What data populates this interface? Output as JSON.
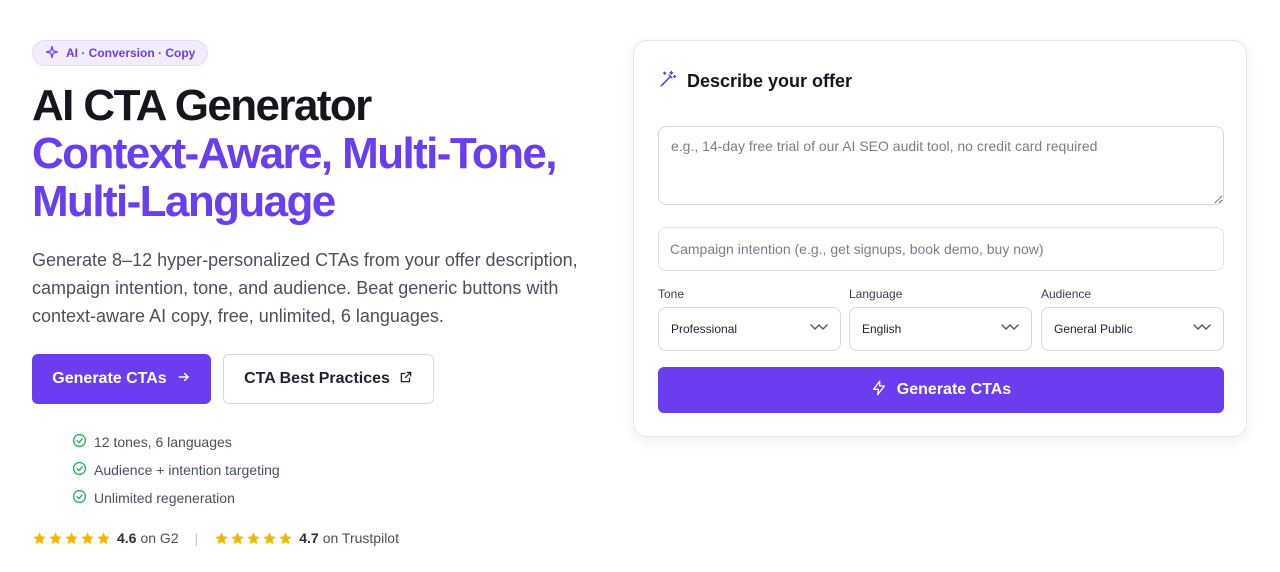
{
  "hero": {
    "badge": "AI · Conversion · Copy",
    "title_line1": "AI CTA Generator",
    "title_line2": "Context-Aware, Multi-Tone, Multi-Language",
    "description": "Generate 8–12 hyper-personalized CTAs from your offer description, campaign intention, tone, and audience. Beat generic buttons with context-aware AI copy, free, unlimited, 6 languages.",
    "primary_button": "Generate CTAs",
    "secondary_button": "CTA Best Practices",
    "features": [
      "12 tones, 6 languages",
      "Audience + intention targeting",
      "Unlimited regeneration"
    ],
    "ratings": [
      {
        "score": "4.6",
        "source": "on G2",
        "stars": 5
      },
      {
        "score": "4.7",
        "source": "on Trustpilot",
        "stars": 5
      }
    ],
    "rating_separator": "|"
  },
  "form": {
    "heading": "Describe your offer",
    "offer_placeholder": "e.g., 14-day free trial of our AI SEO audit tool, no credit card required",
    "intention_placeholder": "Campaign intention (e.g., get signups, book demo, buy now)",
    "tone_label": "Tone",
    "tone_value": "Professional",
    "language_label": "Language",
    "language_value": "English",
    "audience_label": "Audience",
    "audience_value": "General Public",
    "submit_label": "Generate CTAs"
  },
  "icons": {
    "badge": "sparkle-icon",
    "primary_button": "arrow-right-icon",
    "secondary_button": "external-link-icon",
    "feature": "check-circle-icon",
    "rating": "star-icon",
    "heading": "magic-wand-icon",
    "select": "chevron-down-icon",
    "submit": "lightning-icon"
  },
  "colors": {
    "brand": "#6a3df0",
    "heading_text": "#14151f",
    "body_text": "#4b4f60",
    "check": "#22b35e",
    "star": "#f5b800",
    "badge_bg": "#f1edff"
  }
}
